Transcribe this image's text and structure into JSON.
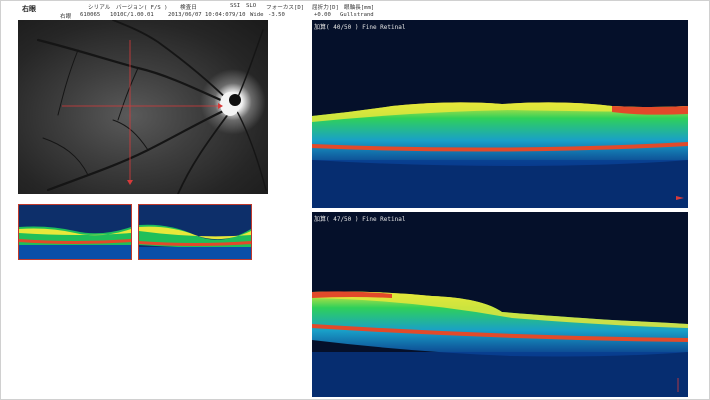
{
  "report": {
    "eye_title": "右眼",
    "header_row1": {
      "serial": "シリアル",
      "version": "バージョン( F/S )",
      "exam_date": "検査日",
      "ssi": "SSI",
      "slo": "SLO",
      "focus": "フォーカス[D]",
      "refraction": "屈折力[D]",
      "axial": "眼軸長[mm]"
    },
    "header_row2": {
      "eye": "右眼",
      "serial_value": "610065",
      "version_value": "1010C/1.00.01",
      "exam_datetime": "2013/06/07 10:04:07",
      "ssi_value": "9/10",
      "slo_value": "Wide",
      "focus_value": "-3.50",
      "refraction_value": "+0.00",
      "axial_value": "Gullstrand"
    }
  },
  "scans": [
    {
      "label": "加算( 40/50 )  Fine  Retinal"
    },
    {
      "label": "加算( 47/50 )  Fine  Retinal"
    }
  ],
  "colors": {
    "scan_line": "#d83a3a",
    "oct_background": "#05102a",
    "thumb_border": "#c0392b"
  }
}
